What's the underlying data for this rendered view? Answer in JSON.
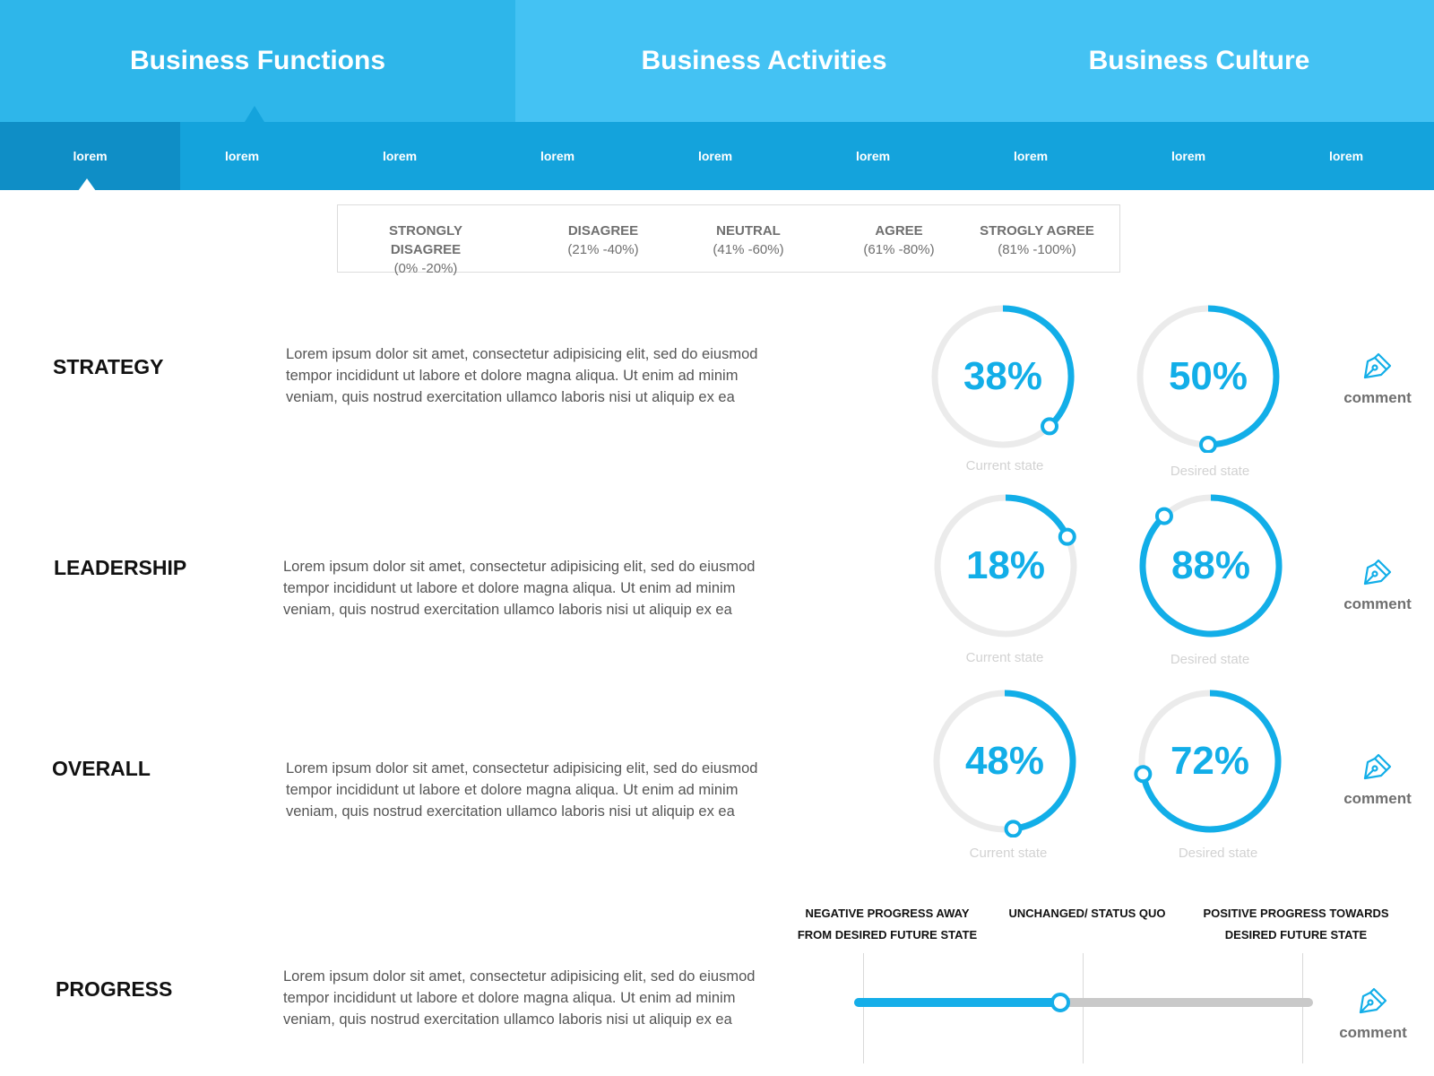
{
  "top_tabs": [
    "Business Functions",
    "Business Activities",
    "Business Culture"
  ],
  "sub_tabs": [
    "lorem",
    "lorem",
    "lorem",
    "lorem",
    "lorem",
    "lorem",
    "lorem",
    "lorem",
    "lorem"
  ],
  "legend": [
    {
      "label": "STRONGLY DISAGREE",
      "range": "(0% -20%)"
    },
    {
      "label": "DISAGREE",
      "range": "(21% -40%)"
    },
    {
      "label": "NEUTRAL",
      "range": "(41% -60%)"
    },
    {
      "label": "AGREE",
      "range": "(61% -80%)"
    },
    {
      "label": "STROGLY AGREE",
      "range": "(81% -100%)"
    }
  ],
  "lorem": "Lorem ipsum dolor sit amet, consectetur adipisicing elit, sed do eiusmod tempor incididunt ut labore et dolore magna aliqua. Ut enim ad minim veniam, quis nostrud exercitation ullamco laboris nisi ut aliquip ex ea",
  "rows": [
    {
      "label": "STRATEGY",
      "current": {
        "value": 38,
        "text": "38%",
        "caption": "Current state"
      },
      "desired": {
        "value": 50,
        "text": "50%",
        "caption": "Desired state"
      },
      "comment": "comment"
    },
    {
      "label": "LEADERSHIP",
      "current": {
        "value": 18,
        "text": "18%",
        "caption": "Current state"
      },
      "desired": {
        "value": 88,
        "text": "88%",
        "caption": "Desired state"
      },
      "comment": "comment"
    },
    {
      "label": "OVERALL",
      "current": {
        "value": 48,
        "text": "48%",
        "caption": "Current state"
      },
      "desired": {
        "value": 72,
        "text": "72%",
        "caption": "Desired state"
      },
      "comment": "comment"
    }
  ],
  "progress": {
    "label": "PROGRESS",
    "headers": [
      "NEGATIVE PROGRESS AWAY FROM DESIRED FUTURE STATE",
      "UNCHANGED/ STATUS QUO",
      "POSITIVE PROGRESS TOWARDS DESIRED FUTURE STATE"
    ],
    "header_lines": [
      [
        "NEGATIVE PROGRESS AWAY",
        "FROM DESIRED FUTURE STATE"
      ],
      [
        "UNCHANGED/ STATUS QUO"
      ],
      [
        "POSITIVE PROGRESS TOWARDS",
        "DESIRED FUTURE STATE"
      ]
    ],
    "value_fraction": 0.45,
    "comment": "comment"
  },
  "colors": {
    "accent": "#12aee8",
    "header": "#44c2f3",
    "subheader": "#14a3dc",
    "track": "#ebebeb"
  },
  "icons": {
    "comment": "pen-nib-icon"
  }
}
